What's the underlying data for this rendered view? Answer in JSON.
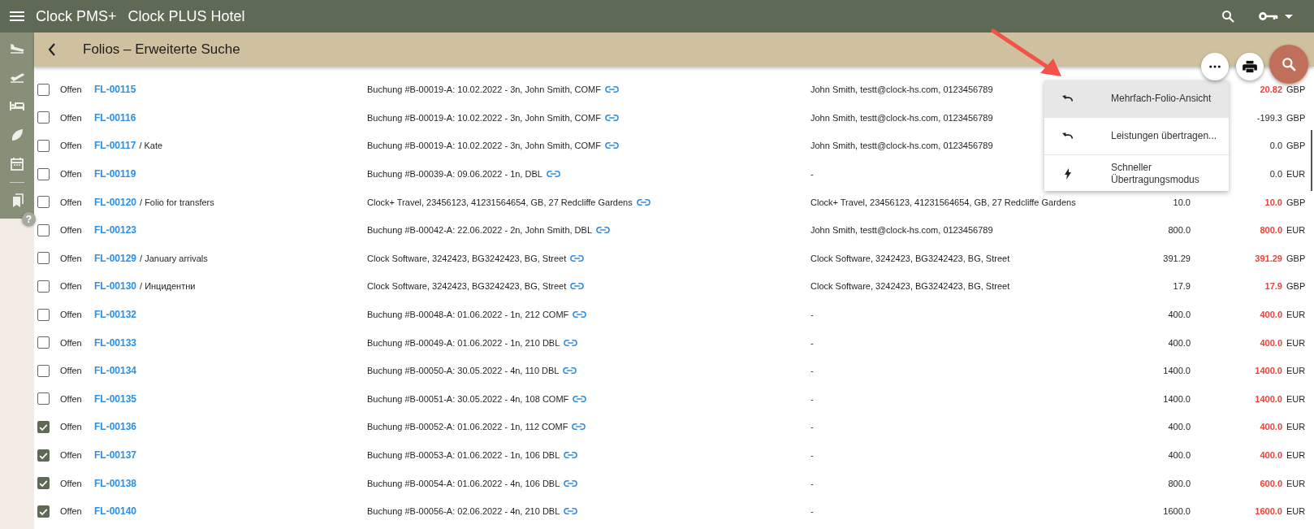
{
  "app_bar": {
    "title": "Clock PMS+",
    "property": "Clock PLUS Hotel"
  },
  "help": {
    "label": "?"
  },
  "page_header": {
    "title": "Folios – Erweiterte Suche"
  },
  "menu": {
    "items": [
      {
        "label": "Mehrfach-Folio-Ansicht",
        "kind": "undo",
        "selected": true
      },
      {
        "label": "Leistungen übertragen...",
        "kind": "undo",
        "selected": false
      },
      {
        "label": "Schneller Übertragungsmodus",
        "kind": "bolt",
        "selected": false
      }
    ]
  },
  "folios": [
    {
      "checked": false,
      "status": "Offen",
      "number": "FL-00115",
      "booking": "Buchung #B-00019-A: 10.02.2022 - 3n, John Smith, COMF",
      "contact": "John Smith, testt@clock-hs.com, 0123456789",
      "balance": "20.82",
      "balance_alert": true,
      "currency": "GBP"
    },
    {
      "checked": false,
      "status": "Offen",
      "number": "FL-00116",
      "booking": "Buchung #B-00019-A: 10.02.2022 - 3n, John Smith, COMF",
      "contact": "John Smith, testt@clock-hs.com, 0123456789",
      "balance": "-199.3",
      "balance_alert": false,
      "currency": "GBP"
    },
    {
      "checked": false,
      "status": "Offen",
      "number": "FL-00117",
      "note": "/ Kate",
      "booking": "Buchung #B-00019-A: 10.02.2022 - 3n, John Smith, COMF",
      "contact": "John Smith, testt@clock-hs.com, 0123456789",
      "balance": "0.0",
      "balance_alert": false,
      "currency": "GBP"
    },
    {
      "checked": false,
      "status": "Offen",
      "number": "FL-00119",
      "booking": "Buchung #B-00039-A: 09.06.2022 - 1n, DBL",
      "contact": "-",
      "balance": "0.0",
      "balance_alert": false,
      "currency": "EUR"
    },
    {
      "checked": false,
      "status": "Offen",
      "number": "FL-00120",
      "note": "/ Folio for transfers",
      "booking": "Clock+ Travel, 23456123, 41231564654, GB, 27 Redcliffe Gardens",
      "contact": "Clock+ Travel, 23456123, 41231564654, GB, 27 Redcliffe Gardens",
      "amount": "10.0",
      "balance": "10.0",
      "balance_alert": true,
      "currency": "GBP"
    },
    {
      "checked": false,
      "status": "Offen",
      "number": "FL-00123",
      "booking": "Buchung #B-00042-A: 22.06.2022 - 2n, John Smith, DBL",
      "contact": "John Smith, testt@clock-hs.com, 0123456789",
      "amount": "800.0",
      "balance": "800.0",
      "balance_alert": true,
      "currency": "EUR"
    },
    {
      "checked": false,
      "status": "Offen",
      "number": "FL-00129",
      "note": "/ January arrivals",
      "booking": "Clock Software, 3242423, BG3242423, BG, Street",
      "contact": "Clock Software, 3242423, BG3242423, BG, Street",
      "amount": "391.29",
      "balance": "391.29",
      "balance_alert": true,
      "currency": "GBP"
    },
    {
      "checked": false,
      "status": "Offen",
      "number": "FL-00130",
      "note": "/ Инцидентни",
      "booking": "Clock Software, 3242423, BG3242423, BG, Street",
      "contact": "Clock Software, 3242423, BG3242423, BG, Street",
      "amount": "17.9",
      "balance": "17.9",
      "balance_alert": true,
      "currency": "GBP"
    },
    {
      "checked": false,
      "status": "Offen",
      "number": "FL-00132",
      "booking": "Buchung #B-00048-A: 01.06.2022 - 1n, 212 COMF",
      "contact": "-",
      "amount": "400.0",
      "balance": "400.0",
      "balance_alert": true,
      "currency": "EUR"
    },
    {
      "checked": false,
      "status": "Offen",
      "number": "FL-00133",
      "booking": "Buchung #B-00049-A: 01.06.2022 - 1n, 210 DBL",
      "contact": "-",
      "amount": "400.0",
      "balance": "400.0",
      "balance_alert": true,
      "currency": "EUR"
    },
    {
      "checked": false,
      "status": "Offen",
      "number": "FL-00134",
      "booking": "Buchung #B-00050-A: 30.05.2022 - 4n, 110 DBL",
      "contact": "-",
      "amount": "1400.0",
      "balance": "1400.0",
      "balance_alert": true,
      "currency": "EUR"
    },
    {
      "checked": false,
      "status": "Offen",
      "number": "FL-00135",
      "booking": "Buchung #B-00051-A: 30.05.2022 - 4n, 108 COMF",
      "contact": "-",
      "amount": "1400.0",
      "balance": "1400.0",
      "balance_alert": true,
      "currency": "EUR"
    },
    {
      "checked": true,
      "status": "Offen",
      "number": "FL-00136",
      "booking": "Buchung #B-00052-A: 01.06.2022 - 1n, 112 COMF",
      "contact": "-",
      "amount": "400.0",
      "balance": "400.0",
      "balance_alert": true,
      "currency": "EUR"
    },
    {
      "checked": true,
      "status": "Offen",
      "number": "FL-00137",
      "booking": "Buchung #B-00053-A: 01.06.2022 - 1n, 106 DBL",
      "contact": "-",
      "amount": "400.0",
      "balance": "400.0",
      "balance_alert": true,
      "currency": "EUR"
    },
    {
      "checked": true,
      "status": "Offen",
      "number": "FL-00138",
      "booking": "Buchung #B-00054-A: 01.06.2022 - 4n, 106 DBL",
      "contact": "-",
      "amount": "800.0",
      "balance": "600.0",
      "balance_alert": true,
      "currency": "EUR"
    },
    {
      "checked": true,
      "status": "Offen",
      "number": "FL-00140",
      "booking": "Buchung #B-00056-A: 02.06.2022 - 4n, 210 DBL",
      "contact": "-",
      "amount": "1600.0",
      "balance": "1600.0",
      "balance_alert": true,
      "currency": "EUR"
    }
  ]
}
